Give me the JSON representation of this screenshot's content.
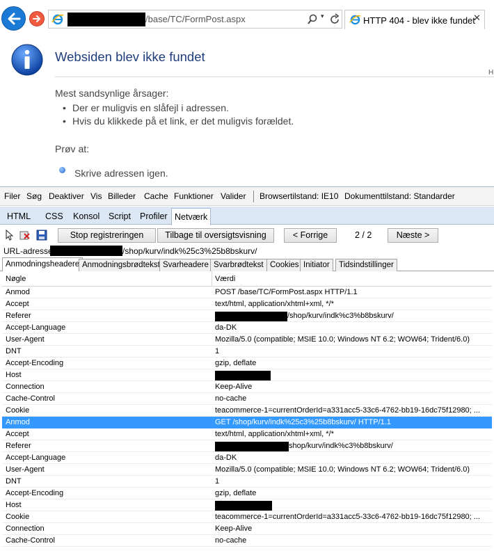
{
  "browser": {
    "address_text": "/base/TC/FormPost.aspx",
    "tab_title": "HTTP 404 - blev ikke fundet",
    "tab_close": "✕"
  },
  "error_page": {
    "title": "Websiden blev ikke fundet",
    "corner_letter": "H",
    "causes_heading": "Mest sandsynlige årsager:",
    "causes": [
      "Der er muligvis en slåfejl i adressen.",
      "Hvis du klikkede på et link, er det muligvis forældet."
    ],
    "try_heading": "Prøv at:",
    "try_item": "Skrive adressen igen."
  },
  "devtools": {
    "menu": [
      "Filer",
      "Søg",
      "Deaktiver",
      "Vis",
      "Billeder",
      "Cache",
      "Funktioner",
      "Valider",
      "Browsertilstand: IE10",
      "Dokumenttilstand: Standarder"
    ],
    "tabs": [
      "HTML",
      "CSS",
      "Konsol",
      "Script",
      "Profiler",
      "Netværk"
    ],
    "active_tab": "Netværk",
    "toolbar": {
      "stop_label": "Stop registreringen",
      "back_label": "Tilbage til oversigtsvisning",
      "prev_label": "< Forrige",
      "count": "2 / 2",
      "next_label": "Næste >"
    },
    "url_label": "URL-adresse:",
    "url_value": "/shop/kurv/indk%25c3%25b8bskurv/",
    "subtabs": [
      "Anmodningsheadere",
      "Anmodningsbrødtekst",
      "Svarheadere",
      "Svarbrødtekst",
      "Cookies",
      "Initiator",
      "Tidsindstillinger"
    ],
    "active_subtab": "Anmodningsheadere",
    "columns": [
      "Nøgle",
      "Værdi"
    ],
    "rows": [
      {
        "key": "Anmod",
        "value": "POST /base/TC/FormPost.aspx HTTP/1.1"
      },
      {
        "key": "Accept",
        "value": "text/html, application/xhtml+xml, */*"
      },
      {
        "key": "Referer",
        "value": "/shop/kurv/indk%c3%b8bskurv/",
        "redact": true
      },
      {
        "key": "Accept-Language",
        "value": "da-DK"
      },
      {
        "key": "User-Agent",
        "value": "Mozilla/5.0 (compatible; MSIE 10.0; Windows NT 6.2; WOW64; Trident/6.0)"
      },
      {
        "key": "DNT",
        "value": "1"
      },
      {
        "key": "Accept-Encoding",
        "value": "gzip, deflate"
      },
      {
        "key": "Host",
        "value": "",
        "redact": true
      },
      {
        "key": "Connection",
        "value": "Keep-Alive"
      },
      {
        "key": "Cache-Control",
        "value": "no-cache"
      },
      {
        "key": "Cookie",
        "value": "teacommerce-1=currentOrderId=a331acc5-33c6-4762-bb19-16dc75f12980; ..."
      },
      {
        "key": "Anmod",
        "value": "GET /shop/kurv/indk%25c3%25b8bskurv/ HTTP/1.1",
        "selected": true
      },
      {
        "key": "Accept",
        "value": "text/html, application/xhtml+xml, */*"
      },
      {
        "key": "Referer",
        "value": "shop/kurv/indk%c3%b8bskurv/",
        "redact": true
      },
      {
        "key": "Accept-Language",
        "value": "da-DK"
      },
      {
        "key": "User-Agent",
        "value": "Mozilla/5.0 (compatible; MSIE 10.0; Windows NT 6.2; WOW64; Trident/6.0)"
      },
      {
        "key": "DNT",
        "value": "1"
      },
      {
        "key": "Accept-Encoding",
        "value": "gzip, deflate"
      },
      {
        "key": "Host",
        "value": "",
        "redact": true
      },
      {
        "key": "Cookie",
        "value": "teacommerce-1=currentOrderId=a331acc5-33c6-4762-bb19-16dc75f12980; ..."
      },
      {
        "key": "Connection",
        "value": "Keep-Alive"
      },
      {
        "key": "Cache-Control",
        "value": "no-cache"
      }
    ]
  }
}
